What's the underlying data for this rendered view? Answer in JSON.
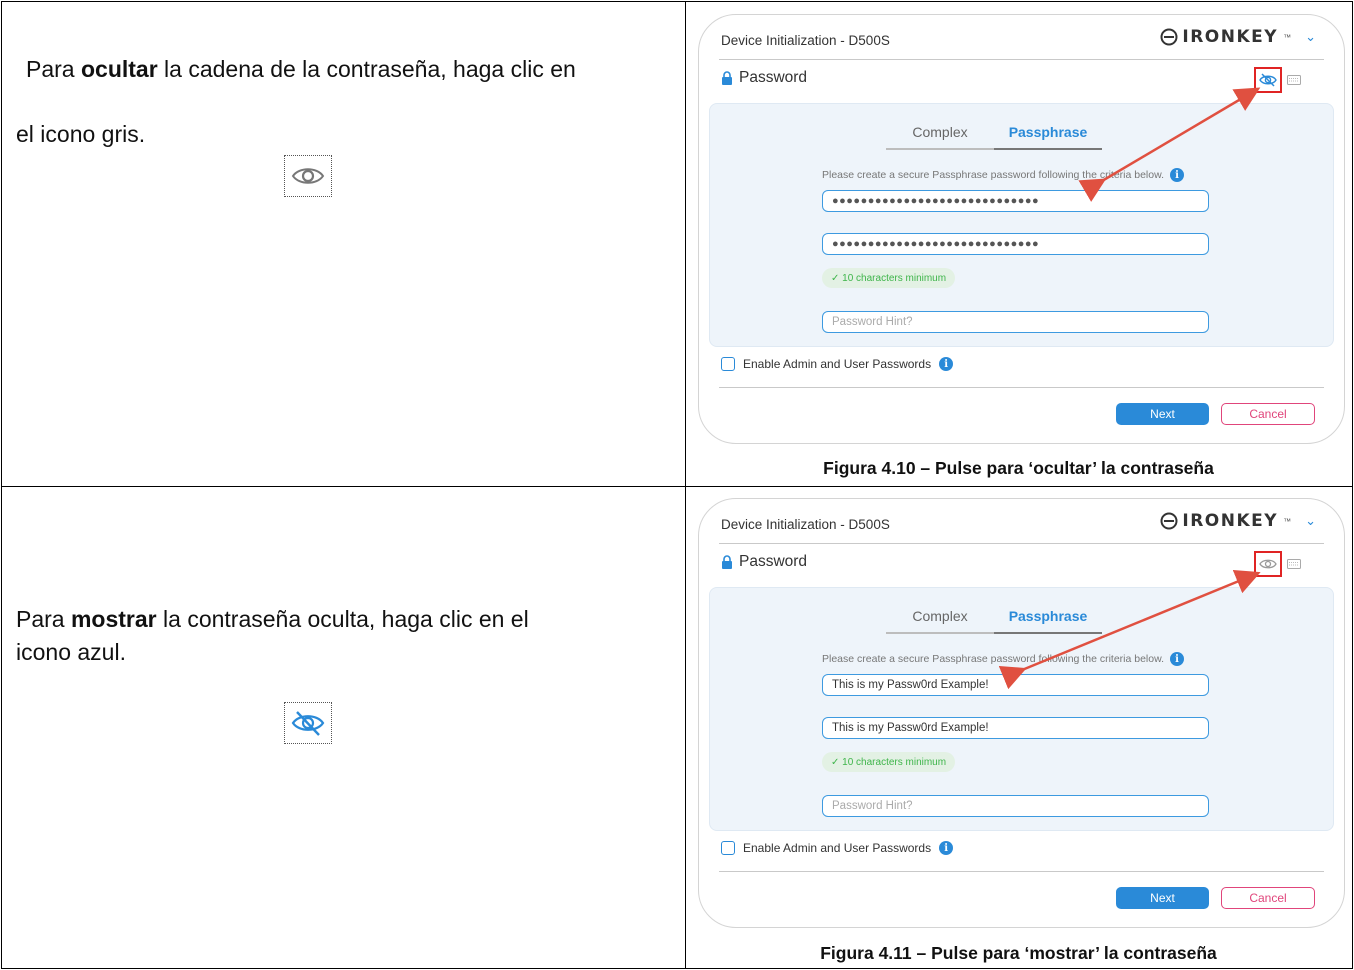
{
  "rows": [
    {
      "instruction_lines": [
        {
          "before": "Para ",
          "bold": "ocultar",
          "after": " la cadena de la contraseña, haga clic en"
        },
        {
          "before": "el icono gris.",
          "bold": "",
          "after": ""
        }
      ],
      "sample_icon": "eye-icon",
      "caption": "Figura 4.10 – Pulse para ‘ocultar’ la contraseña",
      "dialog": {
        "title": "Device Initialization - D500S",
        "brand": "IRONKEY",
        "brand_tm": "™",
        "section": "Password",
        "tabs": [
          "Complex",
          "Passphrase"
        ],
        "active_tab": "Passphrase",
        "criteria": "Please create a secure Passphrase password following the criteria below.",
        "password_value": "●●●●●●●●●●●●●●●●●●●●●●●●●●●●●",
        "confirm_value": "●●●●●●●●●●●●●●●●●●●●●●●●●●●●●",
        "requirement": "✓ 10 characters minimum",
        "hint_placeholder": "Password Hint?",
        "admin_label": "Enable Admin and User Passwords",
        "next_label": "Next",
        "cancel_label": "Cancel",
        "toggle_icon": "eye-slash-icon"
      }
    },
    {
      "instruction_lines": [
        {
          "before": "Para ",
          "bold": "mostrar",
          "after": " la contraseña oculta, haga clic en el"
        },
        {
          "before": "icono azul.",
          "bold": "",
          "after": ""
        }
      ],
      "sample_icon": "eye-slash-icon",
      "caption": "Figura 4.11 – Pulse para ‘mostrar’ la contraseña",
      "dialog": {
        "title": "Device Initialization - D500S",
        "brand": "IRONKEY",
        "brand_tm": "™",
        "section": "Password",
        "tabs": [
          "Complex",
          "Passphrase"
        ],
        "active_tab": "Passphrase",
        "criteria": "Please create a secure Passphrase password following the criteria below.",
        "password_value": "This is my Passw0rd Example!",
        "confirm_value": "This is my Passw0rd Example!",
        "requirement": "✓ 10 characters minimum",
        "hint_placeholder": "Password Hint?",
        "admin_label": "Enable Admin and User Passwords",
        "next_label": "Next",
        "cancel_label": "Cancel",
        "toggle_icon": "eye-icon"
      }
    }
  ],
  "colors": {
    "accent_blue": "#2a8ad8",
    "highlight_red": "#e02424",
    "arrow_red": "#e05040",
    "success_green": "#3fb54b",
    "cancel_pink": "#e0457b"
  }
}
